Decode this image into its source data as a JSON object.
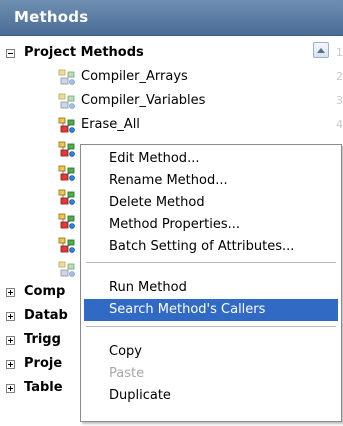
{
  "header": {
    "title": "Methods"
  },
  "tree": {
    "project_methods": {
      "label": "Project Methods",
      "methods": [
        "Compiler_Arrays",
        "Compiler_Variables",
        "Erase_All"
      ]
    },
    "folders": [
      "Comp",
      "Datab",
      "Trigg",
      "Proje",
      "Table"
    ],
    "line_numbers": [
      "1",
      "2",
      "3",
      "4"
    ]
  },
  "context_menu": {
    "items": [
      "Edit Method...",
      "Rename Method...",
      "Delete Method",
      "Method Properties...",
      "Batch Setting of Attributes...",
      "Run Method",
      "Search Method's Callers",
      "Copy",
      "Paste",
      "Duplicate"
    ],
    "highlighted_index": 6,
    "disabled": [
      "Paste"
    ]
  },
  "icons": {
    "method": "method-icon",
    "toggle_expanded": "minus-box-icon",
    "toggle_collapsed": "plus-box-icon"
  },
  "colors": {
    "header": "#4f7199",
    "selection": "#316ac5"
  }
}
